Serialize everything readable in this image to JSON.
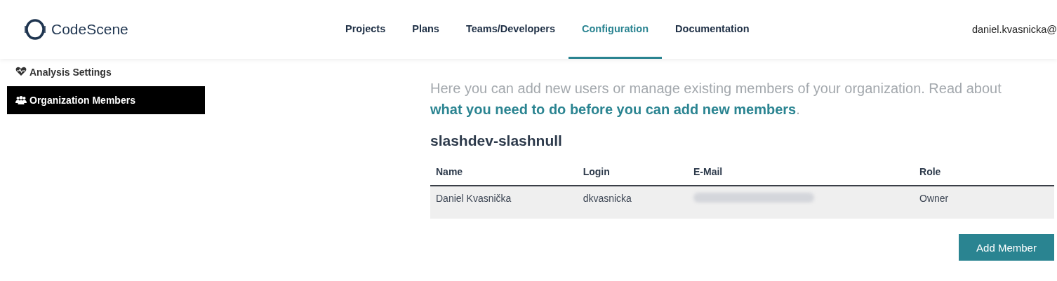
{
  "header": {
    "logo": "CodeScene",
    "nav": [
      {
        "label": "Projects",
        "selected": false
      },
      {
        "label": "Plans",
        "selected": false
      },
      {
        "label": "Teams/Developers",
        "selected": false
      },
      {
        "label": "Configuration",
        "selected": true
      },
      {
        "label": "Documentation",
        "selected": false
      }
    ],
    "user": "daniel.kvasnicka@"
  },
  "sidebar": {
    "items": [
      {
        "label": "Analysis Settings",
        "kind": "analysis",
        "selected": false
      },
      {
        "label": "Organization Members",
        "kind": "members",
        "selected": true
      }
    ]
  },
  "main": {
    "intro": "Here you can add new users or manage existing members of your organization. Read about ",
    "intro_link": "what you need to do before you can add new members",
    "intro_end": ".",
    "org_name": "slashdev-slashnull",
    "table": {
      "columns": [
        "Name",
        "Login",
        "E-Mail",
        "Role"
      ],
      "rows": [
        {
          "name": "Daniel Kvasnička",
          "login": "dkvasnicka",
          "email_redacted": true,
          "role": "Owner"
        }
      ]
    },
    "button": "Add Member"
  }
}
